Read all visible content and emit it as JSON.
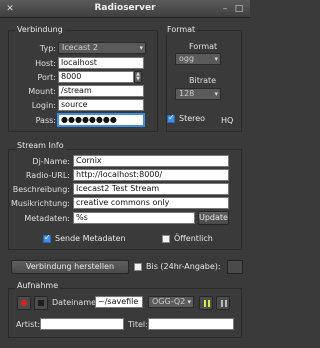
{
  "window": {
    "title": "Radioserver"
  },
  "verbindung": {
    "title": "Verbindung",
    "typ_label": "Typ:",
    "typ_value": "Icecast 2",
    "host_label": "Host:",
    "host_value": "localhost",
    "port_label": "Port:",
    "port_value": "8000",
    "mount_label": "Mount:",
    "mount_value": "/stream",
    "login_label": "Login:",
    "login_value": "source",
    "pass_label": "Pass:",
    "pass_value": "●●●●●●●●"
  },
  "format": {
    "title": "Format",
    "format_label": "Format",
    "format_value": "ogg",
    "bitrate_label": "Bitrate",
    "bitrate_value": "128",
    "stereo_label": "Stereo",
    "stereo_checked": true,
    "hq_label": "HQ"
  },
  "streaminfo": {
    "title": "Stream Info",
    "djname_label": "Dj-Name:",
    "djname_value": "Cornix",
    "radiourl_label": "Radio-URL:",
    "radiourl_value": "http://localhost:8000/",
    "beschreibung_label": "Beschreibung:",
    "beschreibung_value": "Icecast2 Test Stream",
    "musik_label": "Musikrichtung:",
    "musik_value": "creative commons only",
    "metadaten_label": "Metadaten:",
    "metadaten_value": "%s",
    "update_label": "Update",
    "sende_label": "Sende Metadaten",
    "sende_checked": true,
    "oeffentlich_label": "Öffentlich",
    "oeffentlich_checked": false
  },
  "connect": {
    "button_label": "Verbindung herstellen",
    "bis_label": "Bis (24hr-Angabe):",
    "bis_checked": false
  },
  "aufnahme": {
    "title": "Aufnahme",
    "dateiname_label": "Dateiname:",
    "dateiname_value": "~/savefile",
    "codec_value": "OGG-Q2",
    "artist_label": "Artist:",
    "titel_label": "Titel:"
  },
  "colors": {
    "background": "#3a3a3a",
    "accent": "#3d8ee6",
    "record": "#e02020",
    "pause": "#e3e34a"
  }
}
